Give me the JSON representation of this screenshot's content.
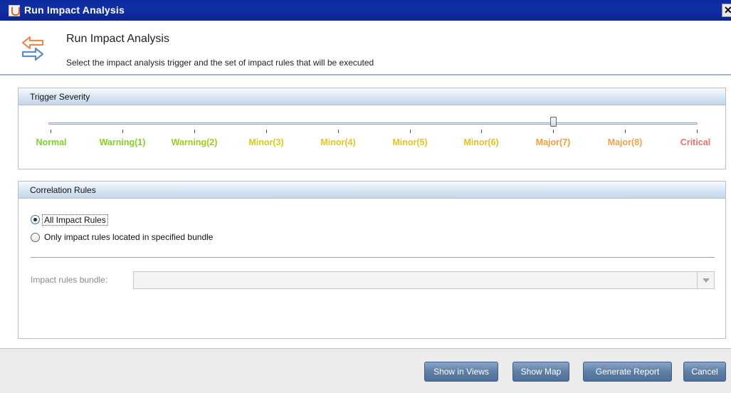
{
  "window": {
    "title": "Run Impact Analysis",
    "close_glyph": "✕"
  },
  "header": {
    "title": "Run Impact Analysis",
    "description": "Select the impact analysis trigger and the set of impact rules that will be executed",
    "icon": "swap-arrows-icon"
  },
  "trigger": {
    "section_title": "Trigger Severity",
    "levels": [
      {
        "label": "Normal",
        "color": "#7fd326"
      },
      {
        "label": "Warning(1)",
        "color": "#86d21c"
      },
      {
        "label": "Warning(2)",
        "color": "#9bd114"
      },
      {
        "label": "Minor(3)",
        "color": "#d4d10e"
      },
      {
        "label": "Minor(4)",
        "color": "#e2cc14"
      },
      {
        "label": "Minor(5)",
        "color": "#e5c715"
      },
      {
        "label": "Minor(6)",
        "color": "#e6c21a"
      },
      {
        "label": "Major(7)",
        "color": "#f4a12c"
      },
      {
        "label": "Major(8)",
        "color": "#f5a148"
      },
      {
        "label": "Critical",
        "color": "#f26d6d"
      }
    ],
    "selected_index": 7
  },
  "rules": {
    "section_title": "Correlation Rules",
    "options": [
      {
        "label": "All Impact Rules",
        "checked": true
      },
      {
        "label": "Only impact rules located in specified bundle",
        "checked": false
      }
    ],
    "bundle_label": "Impact rules bundle:",
    "bundle_value": ""
  },
  "footer": {
    "buttons": [
      "Show in Views",
      "Show Map",
      "Generate Report",
      "Cancel"
    ]
  },
  "colors": {
    "title_bar": "#0a2a9e",
    "button": "#5e7ea5",
    "icon_orange": "#f08a4b",
    "icon_blue": "#5b8cc8"
  }
}
